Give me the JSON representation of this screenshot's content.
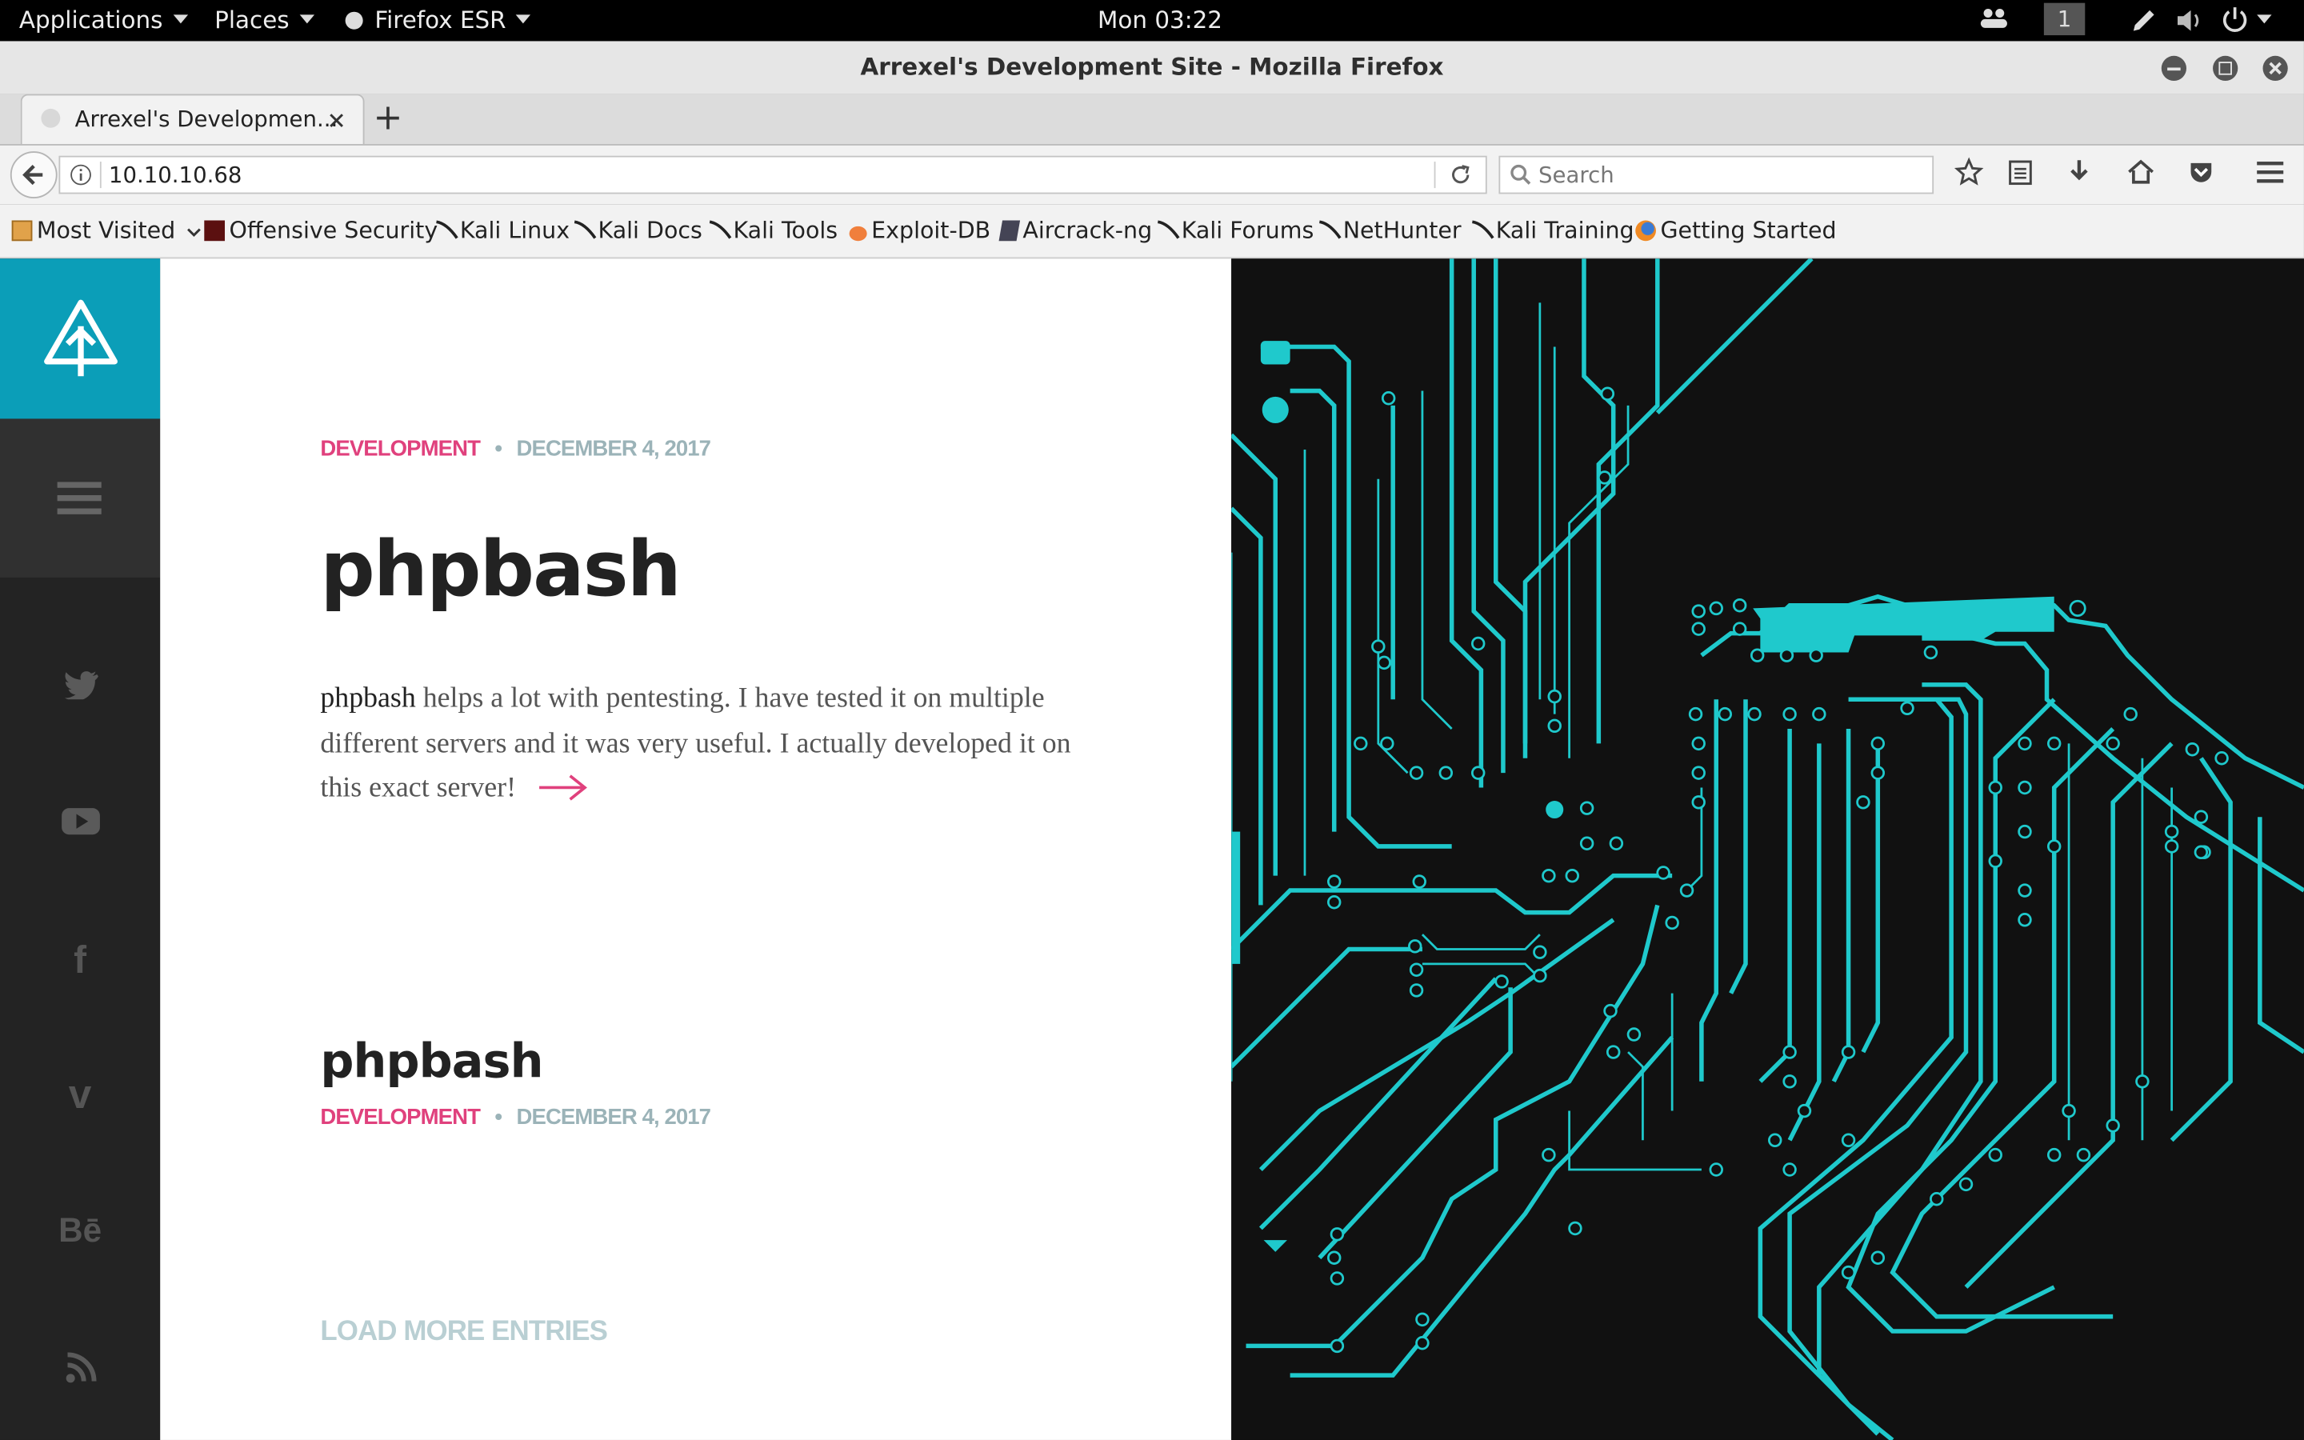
{
  "desktop": {
    "applications": "Applications",
    "places": "Places",
    "firefox_menu": "Firefox ESR",
    "clock": "Mon 03:22",
    "workspace": "1"
  },
  "window": {
    "title": "Arrexel's Development Site - Mozilla Firefox"
  },
  "browser": {
    "tab_title": "Arrexel's Developmen...",
    "url": "10.10.10.68",
    "search_placeholder": "Search",
    "bookmarks": [
      {
        "label": "Most Visited",
        "icon": "folder-icon"
      },
      {
        "label": "Offensive Security",
        "icon": "offsec-icon"
      },
      {
        "label": "Kali Linux",
        "icon": "kali-icon"
      },
      {
        "label": "Kali Docs",
        "icon": "kali-icon"
      },
      {
        "label": "Kali Tools",
        "icon": "kali-icon"
      },
      {
        "label": "Exploit-DB",
        "icon": "exploitdb-icon"
      },
      {
        "label": "Aircrack-ng",
        "icon": "aircrack-icon"
      },
      {
        "label": "Kali Forums",
        "icon": "kali-icon"
      },
      {
        "label": "NetHunter",
        "icon": "kali-icon"
      },
      {
        "label": "Kali Training",
        "icon": "kali-icon"
      },
      {
        "label": "Getting Started",
        "icon": "firefox-icon"
      }
    ]
  },
  "site": {
    "social": [
      {
        "name": "twitter-icon",
        "glyph": "🐦"
      },
      {
        "name": "youtube-icon",
        "glyph": "▶"
      },
      {
        "name": "facebook-icon",
        "glyph": "f"
      },
      {
        "name": "vimeo-icon",
        "glyph": "v"
      },
      {
        "name": "behance-icon",
        "glyph": "Bē"
      },
      {
        "name": "rss-icon",
        "glyph": "◢"
      }
    ],
    "post1": {
      "category": "DEVELOPMENT",
      "date": "DECEMBER 4, 2017",
      "title": "phpbash",
      "excerpt_bold": "phpbash",
      "excerpt": " helps a lot with pentesting. I have tested it on multiple different servers and it was very useful. I actually developed it on this exact server!"
    },
    "post2": {
      "title": "phpbash",
      "category": "DEVELOPMENT",
      "date": "DECEMBER 4, 2017"
    },
    "load_more": "LOAD MORE ENTRIES",
    "accent_color": "#e0417d",
    "brand_color": "#0b9eb8",
    "circuit_color": "#1fc9cc"
  }
}
